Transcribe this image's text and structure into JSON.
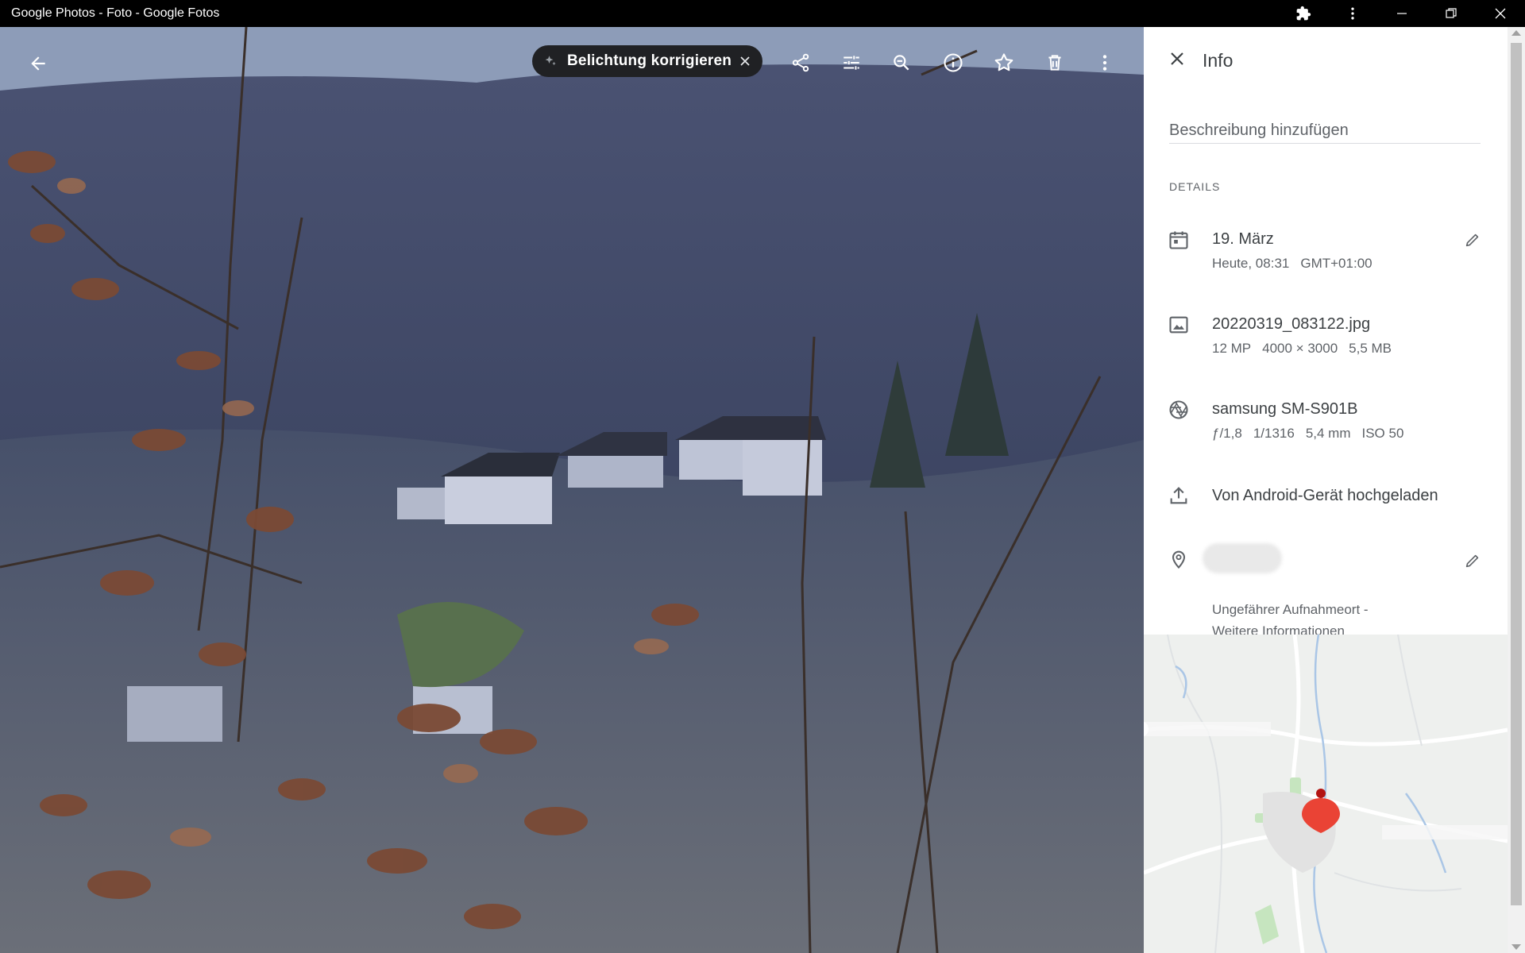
{
  "window": {
    "title": "Google Photos - Foto - Google Fotos"
  },
  "toolbar": {
    "suggestion_chip": "Belichtung korrigieren",
    "icons": [
      "arrow-left-icon",
      "share-icon",
      "tune-icon",
      "zoom-out-icon",
      "info-icon",
      "star-icon",
      "delete-icon",
      "more-vert-icon"
    ]
  },
  "info": {
    "title": "Info",
    "description_placeholder": "Beschreibung hinzufügen",
    "details_label": "DETAILS",
    "date": {
      "primary": "19. März",
      "time": "Heute, 08:31",
      "timezone": "GMT+01:00"
    },
    "file": {
      "name": "20220319_083122.jpg",
      "megapixels": "12 MP",
      "resolution": "4000 × 3000",
      "size": "5,5 MB"
    },
    "camera": {
      "model": "samsung SM-S901B",
      "aperture": "ƒ/1,8",
      "shutter": "1/1316",
      "focal_length": "5,4 mm",
      "iso": "ISO 50"
    },
    "upload": {
      "text": "Von Android-Gerät hochgeladen"
    },
    "location": {
      "note": "Ungefährer Aufnahmeort -",
      "link": "Weitere Informationen"
    }
  },
  "colors": {
    "pin": "#ea4335",
    "chip_bg": "#202124",
    "text_primary": "#3c4043",
    "text_secondary": "#5f6368"
  }
}
